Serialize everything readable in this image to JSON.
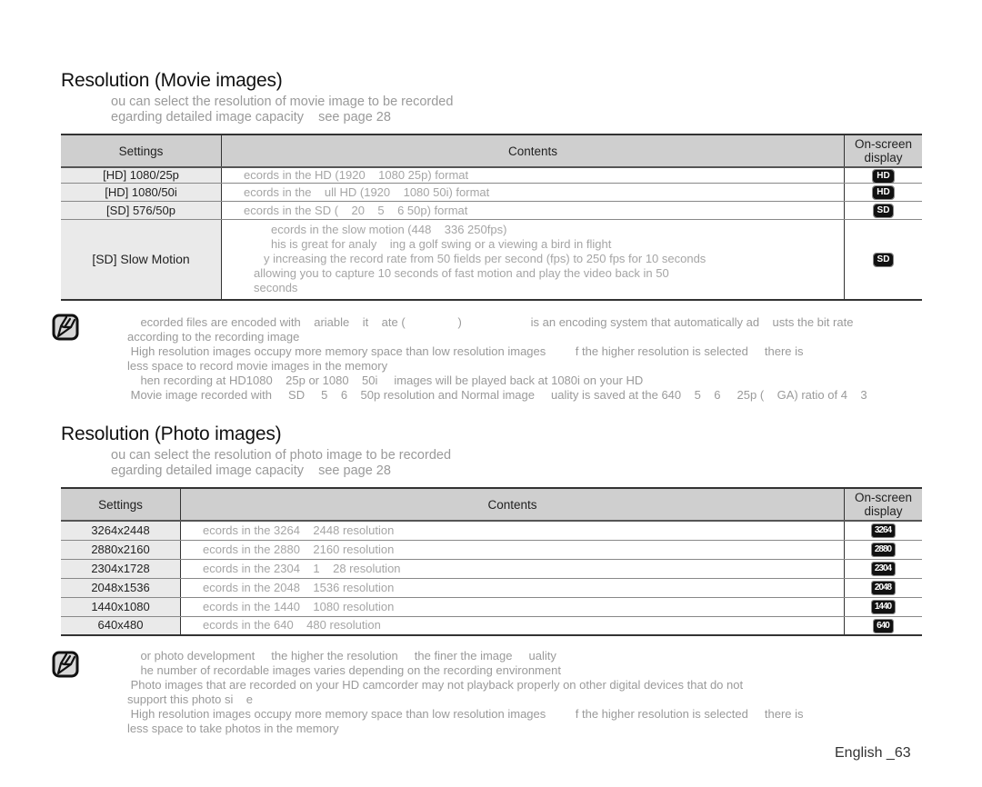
{
  "movie": {
    "title": "Resolution (Movie images)",
    "intro": [
      "ou can select the resolution of movie image to be recorded",
      "egarding detailed image capacity    see page 28"
    ],
    "table": {
      "headers": [
        "Settings",
        "Contents",
        "On-screen display"
      ],
      "rows": [
        {
          "setting": "[HD] 1080/25p",
          "contents": "ecords in the HD (1920    1080 25p) format",
          "display": "HD"
        },
        {
          "setting": "[HD] 1080/50i",
          "contents": "ecords in the    ull HD (1920    1080 50i) format",
          "display": "HD"
        },
        {
          "setting": "[SD] 576/50p",
          "contents": "ecords in the SD (    20    5    6 50p) format",
          "display": "SD"
        },
        {
          "setting": "[SD] Slow Motion",
          "contents_lines": [
            "ecords in the slow motion (448    336 250fps)",
            "his is great for analy    ing a golf swing or a viewing a bird in flight",
            "y increasing the record rate from 50 fields per second (fps) to 250 fps for 10 seconds",
            "allowing you to capture 10 seconds of fast motion and play the video back in 50",
            "seconds"
          ],
          "display": "SD"
        }
      ]
    },
    "notes": [
      "    ecorded files are encoded with    ariable    it    ate (                )                     is an encoding system that automatically ad    usts the bit rate",
      "according to the recording image",
      " High resolution images occupy more memory space than low resolution images         f the higher resolution is selected     there is",
      "less space to record movie images in the memory",
      "    hen recording at HD1080    25p or 1080    50i     images will be played back at 1080i on your HD",
      " Movie image recorded with     SD     5    6    50p resolution and Normal image     uality is saved at the 640    5    6     25p (    GA) ratio of 4    3"
    ]
  },
  "photo": {
    "title": "Resolution (Photo images)",
    "intro": [
      "ou can select the resolution of photo image to be recorded",
      "egarding detailed image capacity    see page 28"
    ],
    "table": {
      "headers": [
        "Settings",
        "Contents",
        "On-screen display"
      ],
      "rows": [
        {
          "setting": "3264x2448",
          "contents": "ecords in the 3264    2448 resolution",
          "display": "3264"
        },
        {
          "setting": "2880x2160",
          "contents": "ecords in the 2880    2160 resolution",
          "display": "2880"
        },
        {
          "setting": "2304x1728",
          "contents": "ecords in the 2304    1    28 resolution",
          "display": "2304"
        },
        {
          "setting": "2048x1536",
          "contents": "ecords in the 2048    1536 resolution",
          "display": "2048"
        },
        {
          "setting": "1440x1080",
          "contents": "ecords in the 1440    1080 resolution",
          "display": "1440"
        },
        {
          "setting": "640x480",
          "contents": "ecords in the 640    480 resolution",
          "display": "640"
        }
      ]
    },
    "notes": [
      "    or photo development     the higher the resolution     the finer the image     uality",
      "    he number of recordable images varies depending on the recording environment",
      " Photo images that are recorded on your HD camcorder may not playback properly on other digital devices that do not",
      "support this photo si    e",
      " High resolution images occupy more memory space than low resolution images         f the higher resolution is selected     there is",
      "less space to take photos in the memory"
    ]
  },
  "footer": {
    "page_label": "English _63"
  },
  "icons": {
    "note": "note-pencil-icon"
  }
}
